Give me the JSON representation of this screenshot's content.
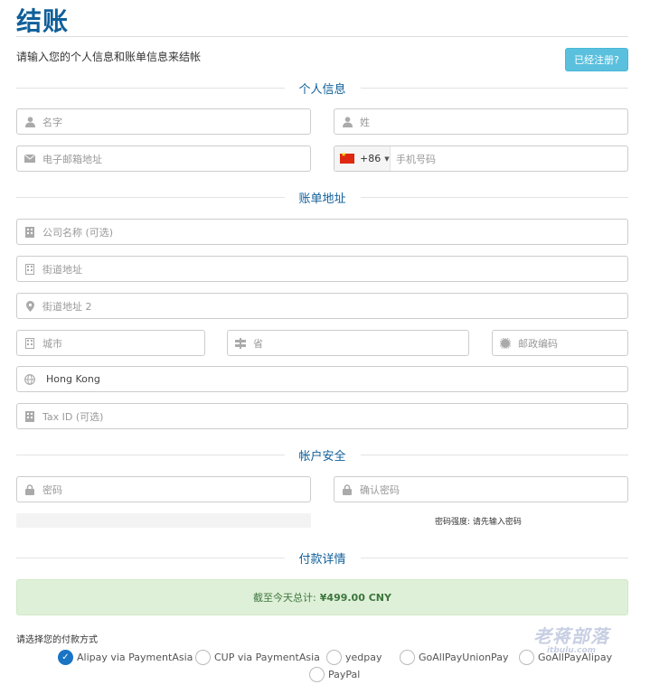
{
  "header": {
    "title": "结账",
    "subtitle": "请输入您的个人信息和账单信息来结帐",
    "registered_button": "已经注册?"
  },
  "personal": {
    "section_title": "个人信息",
    "first_name_placeholder": "名字",
    "last_name_placeholder": "姓",
    "email_placeholder": "电子邮箱地址",
    "phone_country_code": "+86",
    "phone_placeholder": "手机号码"
  },
  "billing": {
    "section_title": "账单地址",
    "company_placeholder": "公司名称 (可选)",
    "street_placeholder": "街道地址",
    "street2_placeholder": "街道地址 2",
    "city_placeholder": "城市",
    "state_placeholder": "省",
    "postcode_placeholder": "邮政编码",
    "country_value": "Hong Kong",
    "tax_placeholder": "Tax ID (可选)"
  },
  "security": {
    "section_title": "帐户安全",
    "password_placeholder": "密码",
    "confirm_placeholder": "确认密码",
    "strength_text": "密码强度: 请先输入密码"
  },
  "payment": {
    "section_title": "付款详情",
    "total_label": "截至今天总计:",
    "total_amount": "¥499.00 CNY",
    "method_label": "请选择您的付款方式",
    "methods": [
      {
        "label": "Alipay via PaymentAsia",
        "checked": true
      },
      {
        "label": "CUP via PaymentAsia",
        "checked": false
      },
      {
        "label": "yedpay",
        "checked": false
      },
      {
        "label": "GoAllPayUnionPay",
        "checked": false
      },
      {
        "label": "GoAllPayAlipay",
        "checked": false
      },
      {
        "label": "PayPal",
        "checked": false
      }
    ]
  },
  "watermark": {
    "line1": "老蒋部落",
    "line2": "itbulu.com"
  },
  "colors": {
    "accent": "#0f5f9a",
    "info_button": "#5bc0de",
    "success_bg": "#dff0d8",
    "radio_checked": "#1a74c4"
  }
}
